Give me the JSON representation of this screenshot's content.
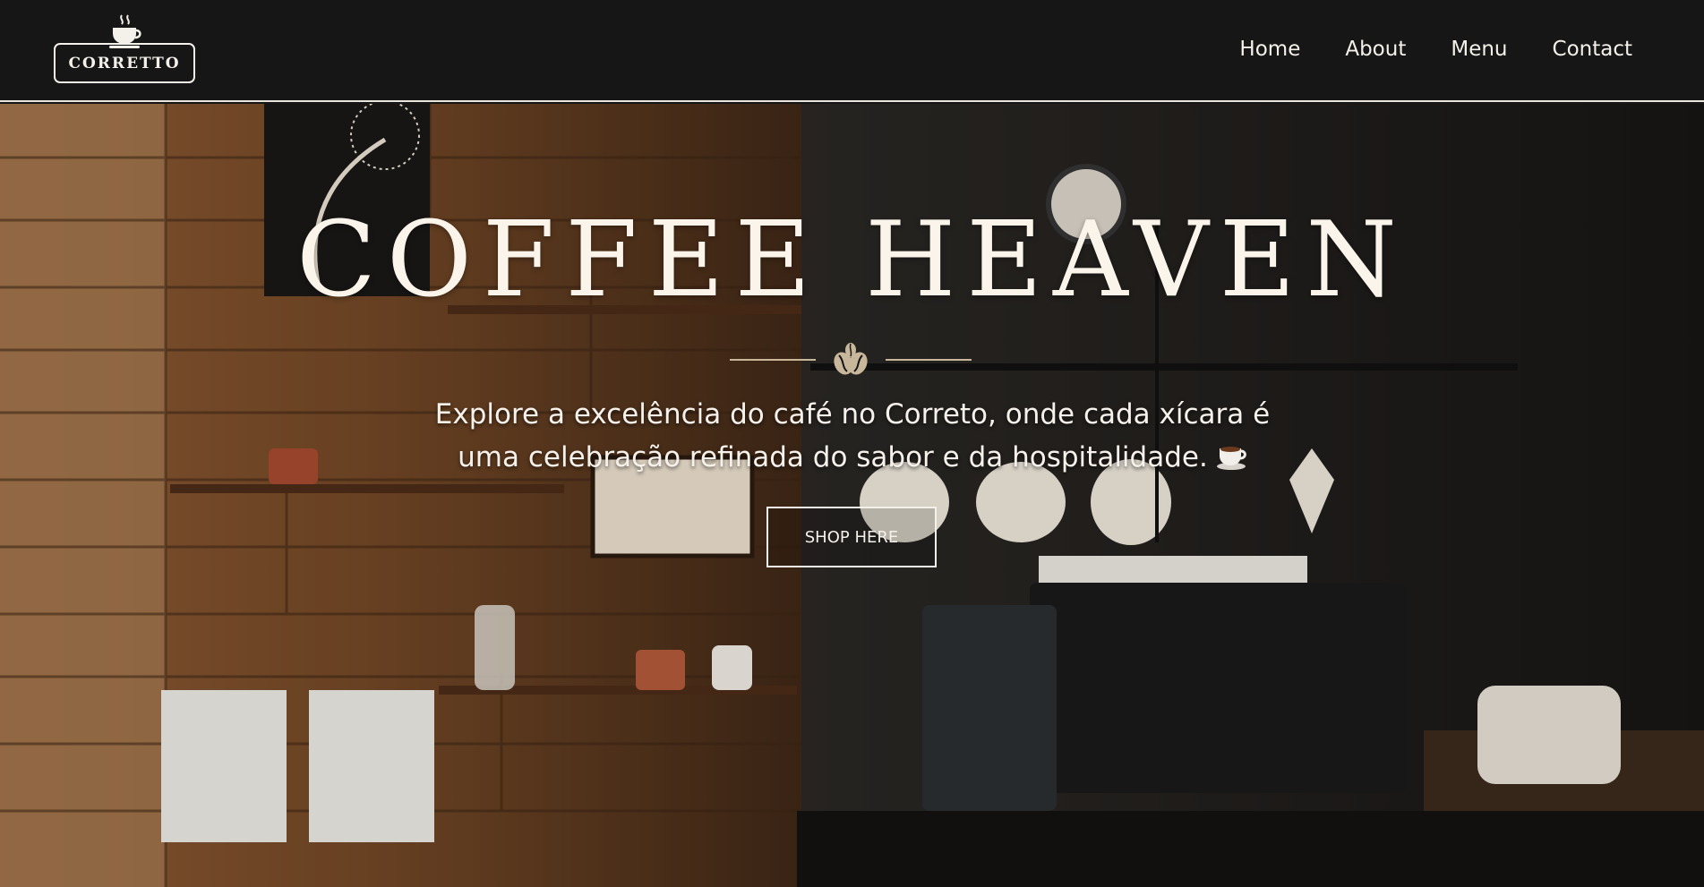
{
  "header": {
    "logo_text": "CORRETTO",
    "nav": [
      {
        "label": "Home"
      },
      {
        "label": "About"
      },
      {
        "label": "Menu"
      },
      {
        "label": "Contact"
      }
    ]
  },
  "hero": {
    "title": "COFFEE HEAVEN",
    "subtitle_line1": "Explore a excelência do café no Correto, onde cada xícara é",
    "subtitle_line2": "uma celebração refinada do sabor e da hospitalidade.",
    "button_label": "SHOP HERE",
    "background": "cafe-interior-photo"
  },
  "colors": {
    "header_bg": "#161616",
    "text_light": "#f4f0ea",
    "accent_beige": "#c9b79b",
    "wood": "#7a4a28"
  },
  "icons": [
    "coffee-cup-logo-icon",
    "coffee-beans-icon",
    "hot-beverage-emoji-icon"
  ]
}
